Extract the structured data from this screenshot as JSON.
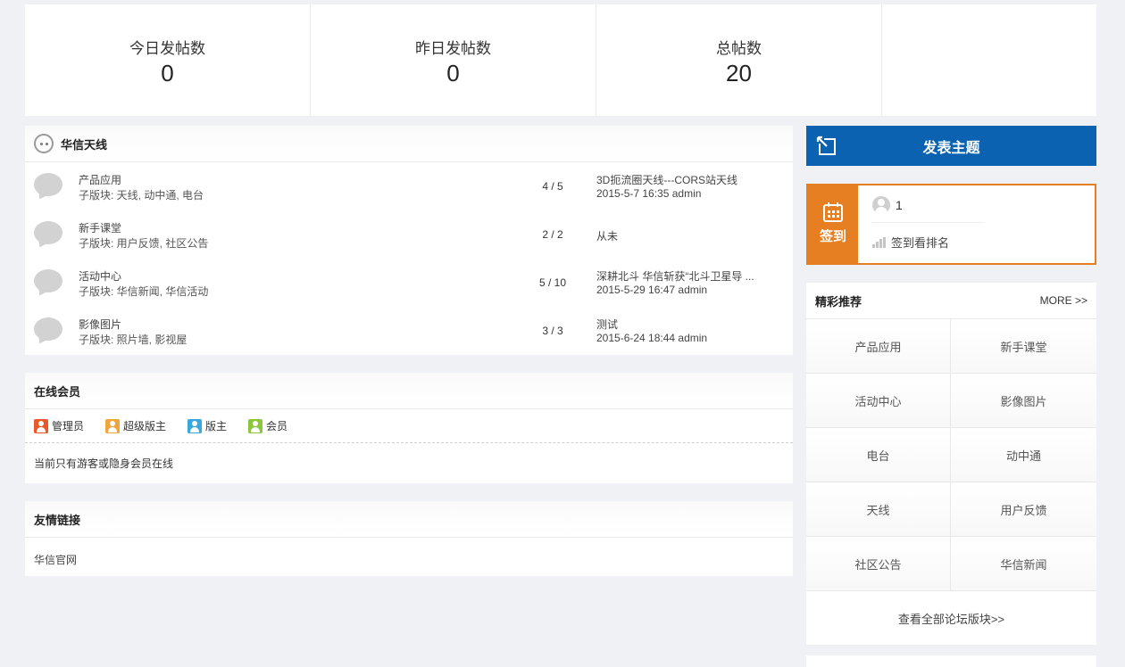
{
  "stats": [
    {
      "label": "今日发帖数",
      "value": "0"
    },
    {
      "label": "昨日发帖数",
      "value": "0"
    },
    {
      "label": "总帖数",
      "value": "20"
    }
  ],
  "forum": {
    "title": "华信天线",
    "rows": [
      {
        "name": "产品应用",
        "sub": "子版块: 天线, 动中通, 电台",
        "count": "4 / 5",
        "last_title": "3D扼流圈天线---CORS站天线",
        "last_meta": "2015-5-7 16:35 admin"
      },
      {
        "name": "新手课堂",
        "sub": "子版块: 用户反馈, 社区公告",
        "count": "2 / 2",
        "last_title": "从未",
        "last_meta": ""
      },
      {
        "name": "活动中心",
        "sub": "子版块: 华信新闻, 华信活动",
        "count": "5 / 10",
        "last_title": "深耕北斗 华信斩获“北斗卫星导 ...",
        "last_meta": "2015-5-29 16:47 admin"
      },
      {
        "name": "影像图片",
        "sub": "子版块: 照片墙, 影视屋",
        "count": "3 / 3",
        "last_title": "测试",
        "last_meta": "2015-6-24 18:44 admin"
      }
    ]
  },
  "online": {
    "title": "在线会员",
    "legend": [
      {
        "label": "管理员",
        "color": "#e8582a"
      },
      {
        "label": "超级版主",
        "color": "#f0a43c"
      },
      {
        "label": "版主",
        "color": "#3aa7dd"
      },
      {
        "label": "会员",
        "color": "#8cc63e"
      }
    ],
    "note": "当前只有游客或隐身会员在线"
  },
  "links": {
    "title": "友情链接",
    "items": [
      "华信官网"
    ]
  },
  "post_button": {
    "label": "发表主题"
  },
  "checkin": {
    "label": "签到",
    "user_count": "1",
    "rank_text": "签到看排名"
  },
  "recommend": {
    "title": "精彩推荐",
    "more": "MORE >>",
    "items": [
      "产品应用",
      "新手课堂",
      "活动中心",
      "影像图片",
      "电台",
      "动中通",
      "天线",
      "用户反馈",
      "社区公告",
      "华信新闻"
    ],
    "all_link": "查看全部论坛版块>>"
  },
  "colors": {
    "accent_blue": "#0a62b0",
    "accent_orange": "#e67e22"
  }
}
